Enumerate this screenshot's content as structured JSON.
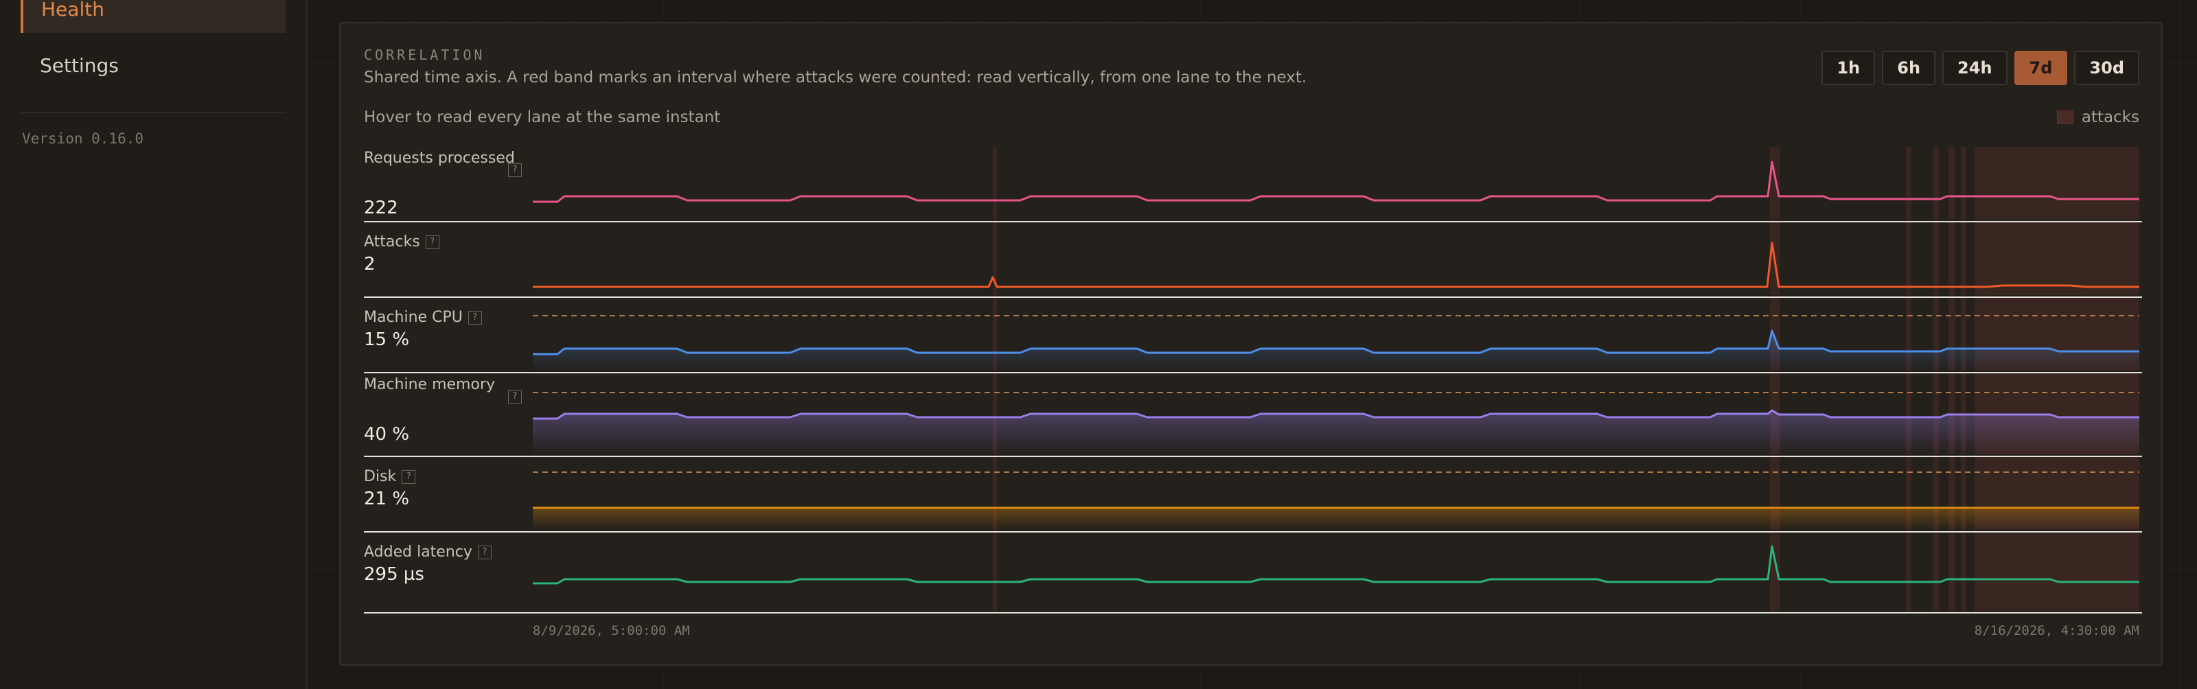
{
  "sidebar": {
    "items": [
      {
        "label": "Health",
        "active": true
      },
      {
        "label": "Settings",
        "active": false
      }
    ],
    "version": "Version 0.16.0"
  },
  "panel": {
    "title": "CORRELATION",
    "description": "Shared time axis. A red band marks an interval where attacks were counted: read vertically, from one lane to the next.",
    "hint": "Hover to read every lane at the same instant",
    "legend_label": "attacks",
    "range_buttons": [
      {
        "label": "1h",
        "active": false
      },
      {
        "label": "6h",
        "active": false
      },
      {
        "label": "24h",
        "active": false
      },
      {
        "label": "7d",
        "active": true
      },
      {
        "label": "30d",
        "active": false
      }
    ],
    "x_start": "8/9/2026, 5:00:00 AM",
    "x_end": "8/16/2026, 4:30:00 AM"
  },
  "colors": {
    "requests": "#e8558a",
    "attacks": "#ee5a2a",
    "cpu": "#4d8fe8",
    "memory": "#9a7ee8",
    "disk": "#d98a0c",
    "latency": "#2cb37a",
    "attack_band": "#4a2b26",
    "threshold": "#b07a4a"
  },
  "lanes": [
    {
      "id": "requests",
      "label": "Requests processed",
      "value": "222",
      "help": "?"
    },
    {
      "id": "attacks",
      "label": "Attacks",
      "value": "2",
      "help": "?"
    },
    {
      "id": "cpu",
      "label": "Machine CPU",
      "value": "15 %",
      "help": "?"
    },
    {
      "id": "memory",
      "label": "Machine memory",
      "value": "40 %",
      "help": "?"
    },
    {
      "id": "disk",
      "label": "Disk",
      "value": "21 %",
      "help": "?"
    },
    {
      "id": "latency",
      "label": "Added latency",
      "value": "295 µs",
      "help": "?"
    }
  ]
}
